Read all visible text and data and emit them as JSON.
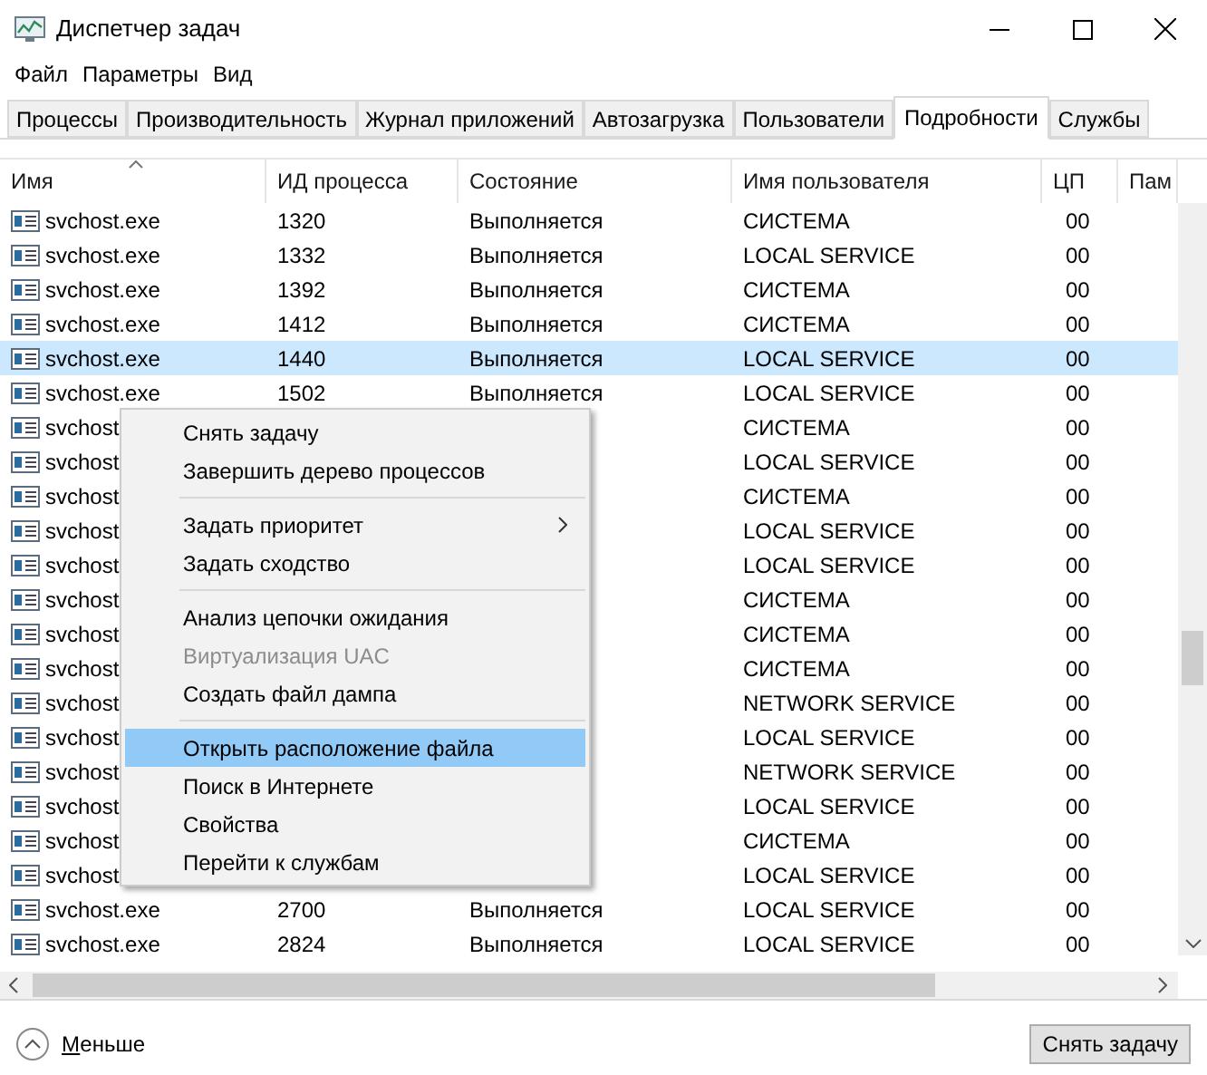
{
  "window": {
    "title": "Диспетчер задач"
  },
  "menu_bar": [
    "Файл",
    "Параметры",
    "Вид"
  ],
  "tabs": [
    {
      "label": "Процессы",
      "selected": false
    },
    {
      "label": "Производительность",
      "selected": false
    },
    {
      "label": "Журнал приложений",
      "selected": false
    },
    {
      "label": "Автозагрузка",
      "selected": false
    },
    {
      "label": "Пользователи",
      "selected": false
    },
    {
      "label": "Подробности",
      "selected": true
    },
    {
      "label": "Службы",
      "selected": false
    }
  ],
  "table": {
    "columns": [
      "Имя",
      "ИД процесса",
      "Состояние",
      "Имя пользователя",
      "ЦП",
      "Пам"
    ],
    "rows": [
      {
        "name": "svchost.exe",
        "pid": "1320",
        "status": "Выполняется",
        "user": "СИСТЕМА",
        "cpu": "00",
        "selected": false
      },
      {
        "name": "svchost.exe",
        "pid": "1332",
        "status": "Выполняется",
        "user": "LOCAL SERVICE",
        "cpu": "00",
        "selected": false
      },
      {
        "name": "svchost.exe",
        "pid": "1392",
        "status": "Выполняется",
        "user": "СИСТЕМА",
        "cpu": "00",
        "selected": false
      },
      {
        "name": "svchost.exe",
        "pid": "1412",
        "status": "Выполняется",
        "user": "СИСТЕМА",
        "cpu": "00",
        "selected": false
      },
      {
        "name": "svchost.exe",
        "pid": "1440",
        "status": "Выполняется",
        "user": "LOCAL SERVICE",
        "cpu": "00",
        "selected": true
      },
      {
        "name": "svchost.exe",
        "pid": "1502",
        "status": "Выполняется",
        "user": "LOCAL SERVICE",
        "cpu": "00",
        "selected": false
      },
      {
        "name": "svchost",
        "user": "СИСТЕМА",
        "cpu": "00",
        "selected": false
      },
      {
        "name": "svchost",
        "user": "LOCAL SERVICE",
        "cpu": "00",
        "selected": false
      },
      {
        "name": "svchost",
        "user": "СИСТЕМА",
        "cpu": "00",
        "selected": false
      },
      {
        "name": "svchost",
        "user": "LOCAL SERVICE",
        "cpu": "00",
        "selected": false
      },
      {
        "name": "svchost",
        "user": "LOCAL SERVICE",
        "cpu": "00",
        "selected": false
      },
      {
        "name": "svchost",
        "user": "СИСТЕМА",
        "cpu": "00",
        "selected": false
      },
      {
        "name": "svchost",
        "user": "СИСТЕМА",
        "cpu": "00",
        "selected": false
      },
      {
        "name": "svchost",
        "user": "СИСТЕМА",
        "cpu": "00",
        "selected": false
      },
      {
        "name": "svchost",
        "user": "NETWORK SERVICE",
        "cpu": "00",
        "selected": false
      },
      {
        "name": "svchost",
        "user": "LOCAL SERVICE",
        "cpu": "00",
        "selected": false
      },
      {
        "name": "svchost",
        "user": "NETWORK SERVICE",
        "cpu": "00",
        "selected": false
      },
      {
        "name": "svchost",
        "user": "LOCAL SERVICE",
        "cpu": "00",
        "selected": false
      },
      {
        "name": "svchost",
        "user": "СИСТЕМА",
        "cpu": "00",
        "selected": false
      },
      {
        "name": "svchost",
        "user": "LOCAL SERVICE",
        "cpu": "00",
        "selected": false
      },
      {
        "name": "svchost.exe",
        "pid": "2700",
        "status": "Выполняется",
        "user": "LOCAL SERVICE",
        "cpu": "00",
        "selected": false
      },
      {
        "name": "svchost.exe",
        "pid": "2824",
        "status": "Выполняется",
        "user": "LOCAL SERVICE",
        "cpu": "00",
        "selected": false
      }
    ]
  },
  "context_menu": [
    {
      "kind": "item",
      "label": "Снять задачу",
      "disabled": false,
      "selected": false,
      "submenu": false
    },
    {
      "kind": "item",
      "label": "Завершить дерево процессов",
      "disabled": false,
      "selected": false,
      "submenu": false
    },
    {
      "kind": "separator"
    },
    {
      "kind": "item",
      "label": "Задать приоритет",
      "disabled": false,
      "selected": false,
      "submenu": true
    },
    {
      "kind": "item",
      "label": "Задать сходство",
      "disabled": false,
      "selected": false,
      "submenu": false
    },
    {
      "kind": "separator"
    },
    {
      "kind": "item",
      "label": "Анализ цепочки ожидания",
      "disabled": false,
      "selected": false,
      "submenu": false
    },
    {
      "kind": "item",
      "label": "Виртуализация UAC",
      "disabled": true,
      "selected": false,
      "submenu": false
    },
    {
      "kind": "item",
      "label": "Создать файл дампа",
      "disabled": false,
      "selected": false,
      "submenu": false
    },
    {
      "kind": "separator"
    },
    {
      "kind": "item",
      "label": "Открыть расположение файла",
      "disabled": false,
      "selected": true,
      "submenu": false
    },
    {
      "kind": "item",
      "label": "Поиск в Интернете",
      "disabled": false,
      "selected": false,
      "submenu": false
    },
    {
      "kind": "item",
      "label": "Свойства",
      "disabled": false,
      "selected": false,
      "submenu": false
    },
    {
      "kind": "item",
      "label": "Перейти к службам",
      "disabled": false,
      "selected": false,
      "submenu": false
    }
  ],
  "footer": {
    "less_label": "Меньше",
    "end_task_button": "Снять задачу"
  }
}
